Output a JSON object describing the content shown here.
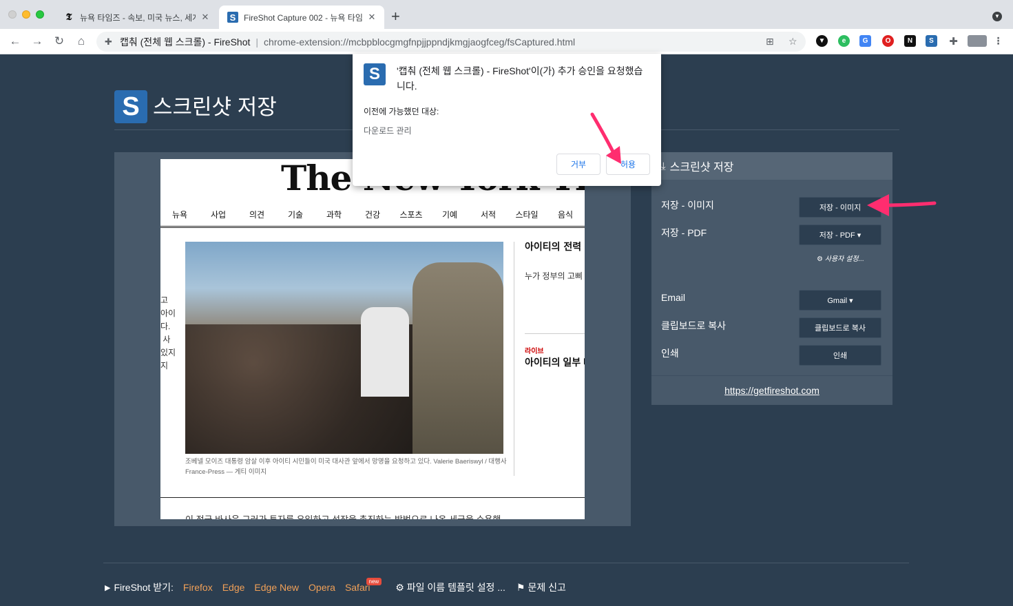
{
  "browser": {
    "tabs": [
      {
        "title": "뉴욕 타임즈 - 속보, 미국 뉴스, 세계"
      },
      {
        "title": "FireShot Capture 002 - 뉴욕 타임"
      }
    ],
    "new_tab_label": "+",
    "omnibox": {
      "site": "캡춰 (전체 웹 스크롤) - FireShot",
      "url": "chrome-extension://mcbpblocgmgfnpjjppndjkmgjaogfceg/fsCaptured.html"
    }
  },
  "popup": {
    "message": "'캡춰 (전체 웹 스크롤) - FireShot'이(가) 추가 승인을 요청했습니다.",
    "previously_label": "이전에 가능했던 대상:",
    "permission": "다운로드 관리",
    "deny_label": "거부",
    "allow_label": "허용"
  },
  "page": {
    "title": "스크린샷 저장",
    "logo_letter": "S"
  },
  "preview": {
    "masthead": "The New York Times",
    "nav": [
      "뉴욕",
      "사업",
      "의견",
      "기술",
      "과학",
      "건강",
      "스포츠",
      "기예",
      "서적",
      "스타일",
      "음식"
    ],
    "caption": "조베넬 모이즈 대통령 암살 이후 아이티 시민들이 미국 대사관 앞에서 망명을 요청하고 있다. Valerie Baeriswyl / 대행사 France-Press — 게티 이미지",
    "side_headline1": "아이티의 전력 Kingmaker의",
    "side_text": "누가 정부의 고삐 대한 전쟁이 공개 분석가들은 복잡 투쟁이 가속화되",
    "live_label": "라이브",
    "side_headline2": "아이티의 일부 다. 다음은 위기",
    "left_fragment": "고\n아이\n다.\n 사\n있지\n지",
    "bottom_text": "이 정국 바사운 그러가 투자를 유입하고 성장을 촉진하는 방법으로 나온 세금을 수용했"
  },
  "panel": {
    "header": "스크린샷 저장",
    "save_image_label": "저장 - 이미지",
    "save_image_button": "저장 - 이미지",
    "save_pdf_label": "저장 - PDF",
    "save_pdf_button": "저장 - PDF ▾",
    "custom_settings": "⚙ 사용자 설정...",
    "email_label": "Email",
    "email_button": "Gmail ▾",
    "clipboard_label": "클립보드로 복사",
    "clipboard_button": "클립보드로 복사",
    "print_label": "인쇄",
    "print_button": "인쇄",
    "link": "https://getfireshot.com"
  },
  "footer": {
    "get_label": "FireShot 받기:",
    "browsers": [
      "Firefox",
      "Edge",
      "Edge New",
      "Opera",
      "Safari"
    ],
    "new_badge": "new",
    "template_settings": "파일 이름 템플릿 설정 ...",
    "report": "문제 신고"
  },
  "colors": {
    "page_bg": "#2c3e50",
    "panel_bg": "#48596a",
    "accent_link": "#f0a058",
    "arrow": "#ff2d6f"
  }
}
